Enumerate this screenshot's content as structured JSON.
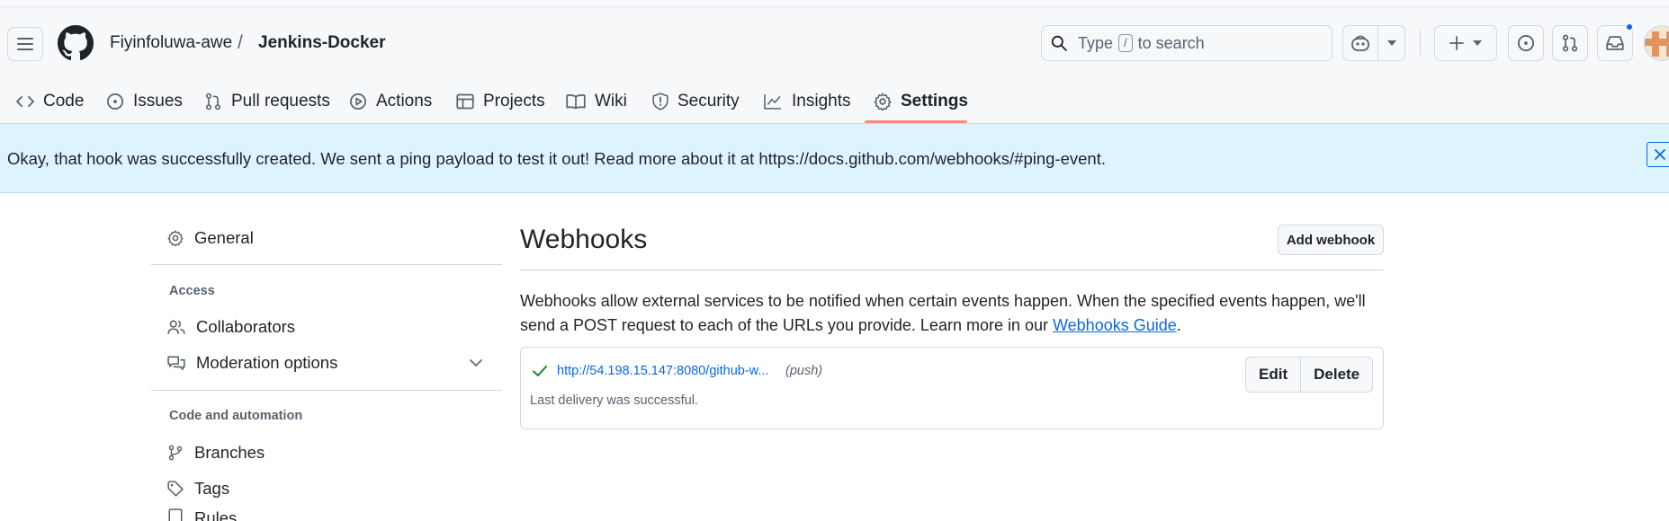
{
  "header": {
    "owner": "Fiyinfoluwa-awe",
    "separator": "/",
    "repo": "Jenkins-Docker",
    "search": {
      "prefix": "Type",
      "key": "/",
      "suffix": "to search"
    }
  },
  "nav": {
    "items": [
      {
        "label": "Code",
        "icon": "code-icon"
      },
      {
        "label": "Issues",
        "icon": "issue-opened-icon"
      },
      {
        "label": "Pull requests",
        "icon": "git-pull-request-icon"
      },
      {
        "label": "Actions",
        "icon": "play-icon"
      },
      {
        "label": "Projects",
        "icon": "table-icon"
      },
      {
        "label": "Wiki",
        "icon": "book-icon"
      },
      {
        "label": "Security",
        "icon": "shield-icon"
      },
      {
        "label": "Insights",
        "icon": "graph-icon"
      },
      {
        "label": "Settings",
        "icon": "gear-icon",
        "selected": true
      }
    ]
  },
  "flash": {
    "message": "Okay, that hook was successfully created. We sent a ping payload to test it out! Read more about it at https://docs.github.com/webhooks/#ping-event."
  },
  "sidebar": {
    "general": "General",
    "access_heading": "Access",
    "collaborators": "Collaborators",
    "moderation": "Moderation options",
    "code_heading": "Code and automation",
    "branches": "Branches",
    "tags": "Tags",
    "rules_partial": "Rules"
  },
  "main": {
    "title": "Webhooks",
    "add_button": "Add webhook",
    "description": "Webhooks allow external services to be notified when certain events happen. When the specified events happen, we'll send a POST request to each of the URLs you provide. Learn more in our ",
    "guide_link": "Webhooks Guide",
    "description_end": ".",
    "hook": {
      "url": "http://54.198.15.147:8080/github-w...",
      "events": "(push)",
      "status": "Last delivery was successful.",
      "edit": "Edit",
      "delete": "Delete"
    }
  },
  "colors": {
    "accent": "#0969da",
    "flash_bg": "#ddf4ff",
    "success": "#1a7f37",
    "tab_underline": "#fd8c73"
  }
}
